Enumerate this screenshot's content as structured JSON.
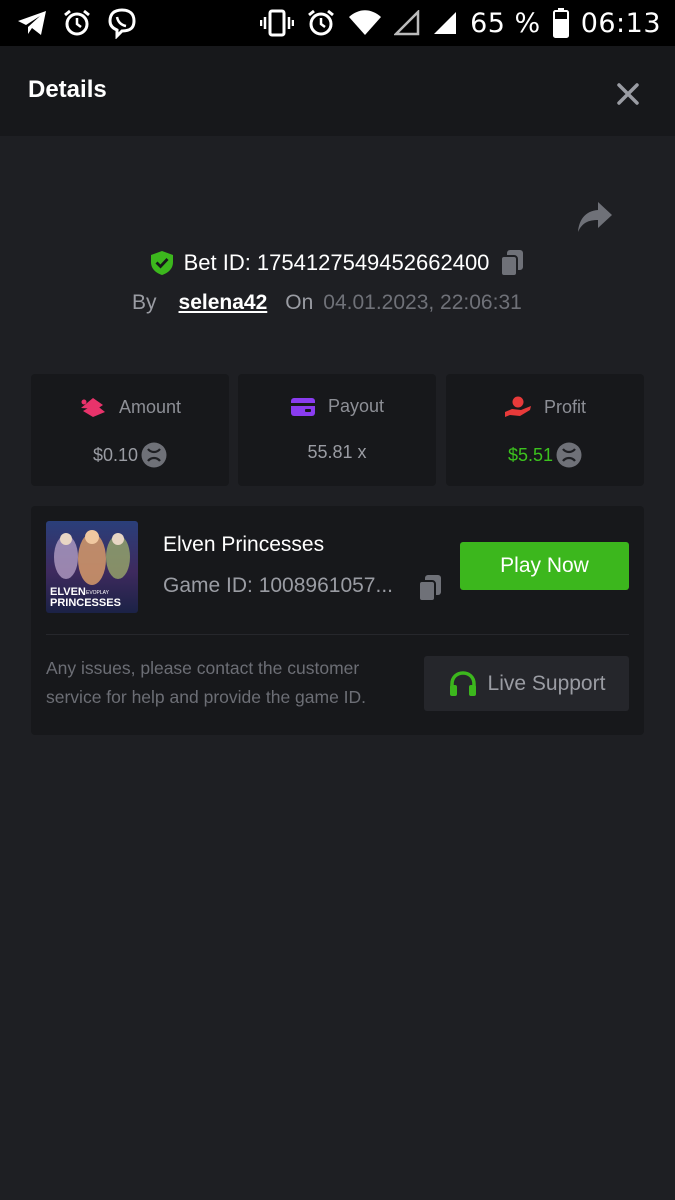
{
  "statusbar": {
    "battery_percent": "65 %",
    "time": "06:13"
  },
  "header": {
    "title": "Details"
  },
  "bet": {
    "id_label": "Bet ID: 1754127549452662400",
    "by_label": "By",
    "username": "selena42",
    "on_label": "On",
    "datetime": "04.01.2023, 22:06:31"
  },
  "stats": {
    "amount": {
      "label": "Amount",
      "value": "$0.10",
      "icon": "amount-icon",
      "color": "#e8336b"
    },
    "payout": {
      "label": "Payout",
      "value": "55.81 x",
      "icon": "wallet-icon",
      "color": "#8a3cf0"
    },
    "profit": {
      "label": "Profit",
      "value": "$5.51",
      "icon": "profit-icon",
      "color": "#e83a3a",
      "value_color": "#3cc21e"
    }
  },
  "game": {
    "name": "Elven Princesses",
    "id_label": "Game ID: 1008961057...",
    "thumb_title": "ELVEN",
    "thumb_subtitle": "PRINCESSES",
    "thumb_brand": "EVOPLAY",
    "play_label": "Play Now"
  },
  "support": {
    "notice": "Any issues, please contact the customer service for help and provide the game ID.",
    "button_label": "Live Support"
  },
  "colors": {
    "accent_green": "#3cb71d",
    "background": "#1e1f23",
    "panel": "#17181b"
  }
}
